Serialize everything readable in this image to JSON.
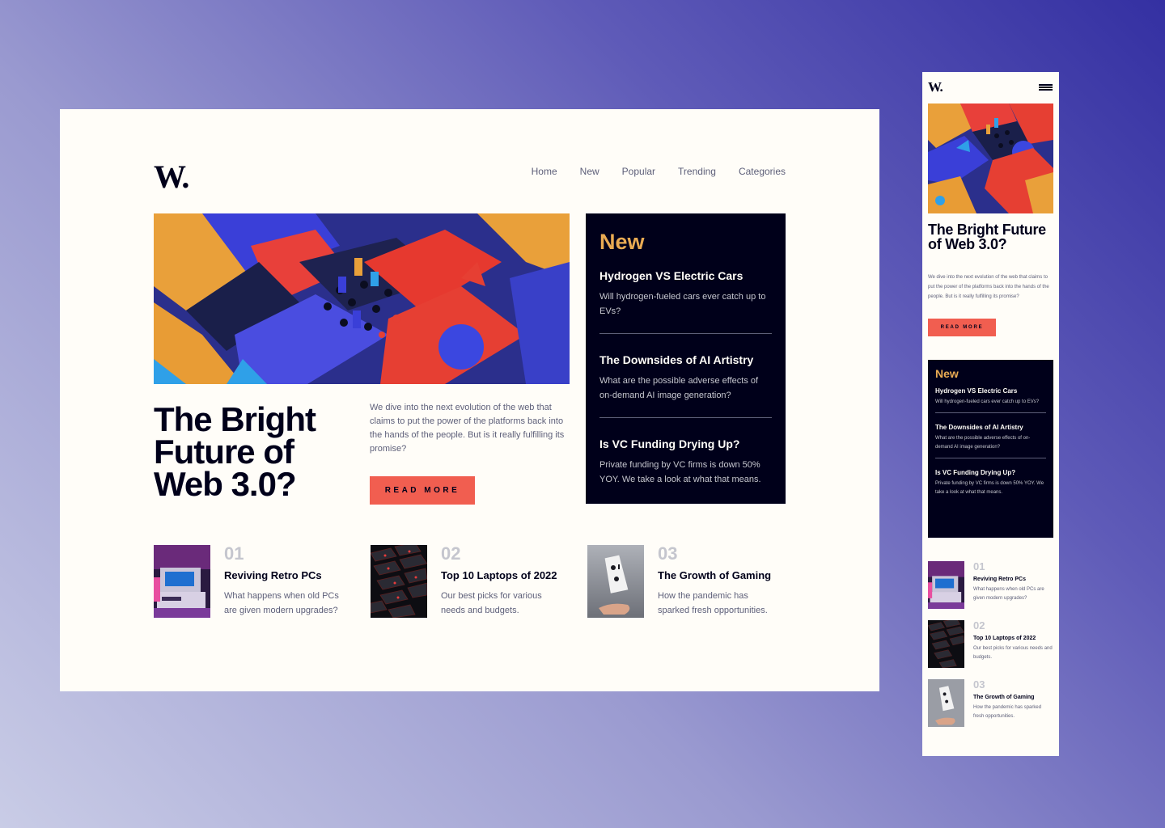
{
  "colors": {
    "accent_orange": "#e9ab53",
    "accent_red": "#f15e50",
    "dark_navy": "#00001a",
    "off_white": "#fffdf8",
    "grayish_blue": "#5d5f79",
    "light_gray": "#c5c6ce"
  },
  "brand": {
    "logo": "W."
  },
  "nav": {
    "items": [
      "Home",
      "New",
      "Popular",
      "Trending",
      "Categories"
    ]
  },
  "hero": {
    "title": "The Bright Future of Web 3.0?",
    "description": "We dive into the next evolution of the web that claims to put the power of the platforms back into the hands of the people. But is it really fulfilling its promise?",
    "button_label": "READ MORE",
    "image_icon": "abstract-3d-blocks-image"
  },
  "new_section": {
    "heading": "New",
    "items": [
      {
        "title": "Hydrogen VS Electric Cars",
        "text": "Will hydrogen-fueled cars ever catch up to EVs?"
      },
      {
        "title": "The Downsides of AI Artistry",
        "text": "What are the possible adverse effects of on-demand AI image generation?"
      },
      {
        "title": "Is VC Funding Drying Up?",
        "text": "Private funding by VC firms is down 50% YOY. We take a look at what that means."
      }
    ]
  },
  "articles": [
    {
      "number": "01",
      "title": "Reviving Retro PCs",
      "text": "What happens when old PCs are given modern upgrades?",
      "image_icon": "retro-pc-image"
    },
    {
      "number": "02",
      "title": "Top 10 Laptops of 2022",
      "text": "Our best picks for various needs and budgets.",
      "image_icon": "keyboard-image"
    },
    {
      "number": "03",
      "title": "The Growth of Gaming",
      "text": "How the pandemic has sparked fresh opportunities.",
      "image_icon": "gamepad-image"
    }
  ],
  "mobile": {
    "menu_icon": "hamburger-menu-icon"
  }
}
